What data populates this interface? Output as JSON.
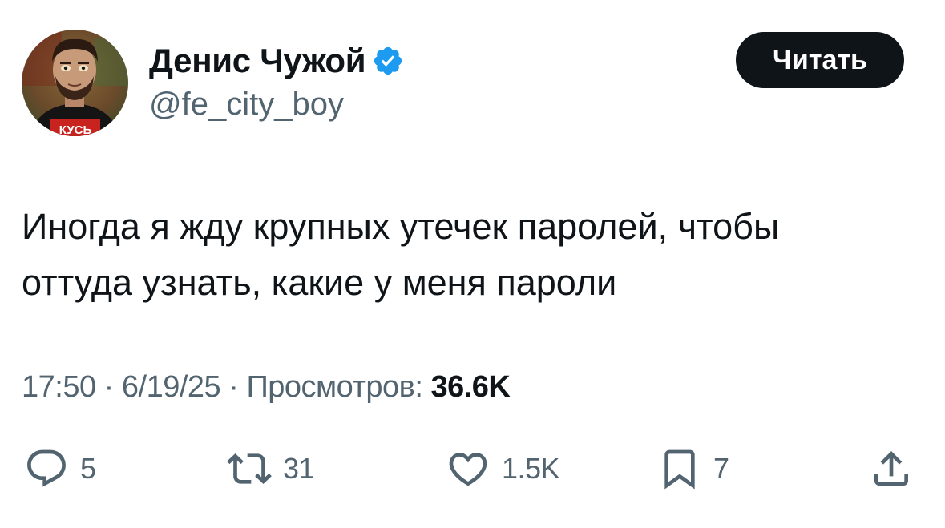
{
  "author": {
    "display_name": "Денис Чужой",
    "handle": "@fe_city_boy",
    "avatar_shirt_text": "КУСЬ",
    "verified_color": "#1d9bf0"
  },
  "follow_button": {
    "label": "Читать"
  },
  "tweet": {
    "line1": "Иногда я жду крупных утечек паролей, чтобы",
    "line2": "оттуда узнать, какие у меня пароли"
  },
  "meta": {
    "time": "17:50",
    "separator": " · ",
    "date": "6/19/25",
    "views_label": "Просмотров:",
    "views_count": "36.6K"
  },
  "actions": {
    "replies": "5",
    "retweets": "31",
    "likes": "1.5K",
    "bookmarks": "7"
  },
  "icons": {
    "reply": "reply-icon",
    "retweet": "retweet-icon",
    "like": "heart-icon",
    "bookmark": "bookmark-icon",
    "share": "share-icon",
    "verified": "verified-badge-icon"
  }
}
